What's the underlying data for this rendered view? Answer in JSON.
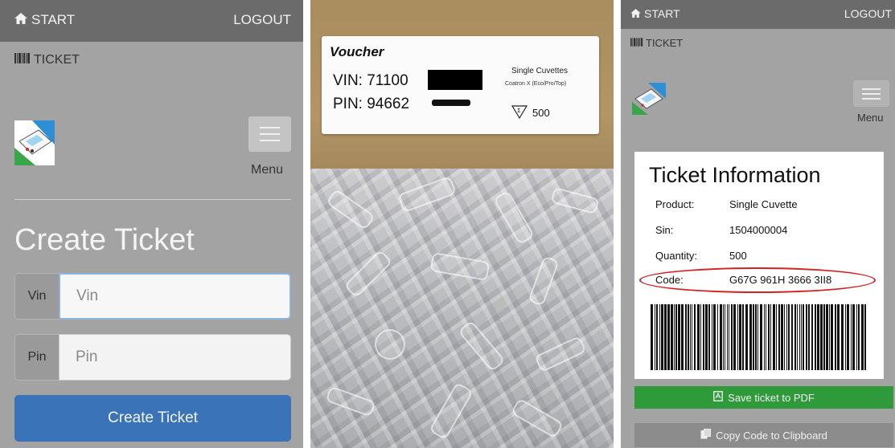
{
  "left": {
    "nav": {
      "start": "START",
      "logout": "LOGOUT",
      "ticket": "TICKET"
    },
    "menu_label": "Menu",
    "heading": "Create Ticket",
    "vin": {
      "addon": "Vin",
      "placeholder": "Vin"
    },
    "pin": {
      "addon": "Pin",
      "placeholder": "Pin"
    },
    "submit_label": "Create Ticket",
    "colors": {
      "topbar": "#6b6b6b",
      "background": "#a3a3a3",
      "submit": "#3a73b8"
    }
  },
  "photo": {
    "label": {
      "title": "Voucher",
      "vin": "VIN:  71100",
      "pin": "PIN:  94662",
      "product": "Single Cuvettes",
      "product_line": "Coatron X (Eco/Pro/Top)",
      "quantity": "500"
    }
  },
  "right": {
    "nav": {
      "start": "START",
      "logout": "LOGOUT",
      "ticket": "TICKET"
    },
    "menu_label": "Menu",
    "card": {
      "title": "Ticket Information",
      "rows": [
        {
          "key": "Product:",
          "value": "Single Cuvette"
        },
        {
          "key": "Sin:",
          "value": "1504000004"
        },
        {
          "key": "Quantity:",
          "value": "500"
        },
        {
          "key": "Code:",
          "value": "G67G 961H 3666 3II8"
        }
      ]
    },
    "buttons": {
      "save_pdf": "Save ticket to PDF",
      "copy_code": "Copy Code to Clipboard"
    },
    "colors": {
      "pdf_button": "#2f9a3a",
      "copy_button": "#8c8c8c",
      "highlight": "#d42020"
    }
  }
}
